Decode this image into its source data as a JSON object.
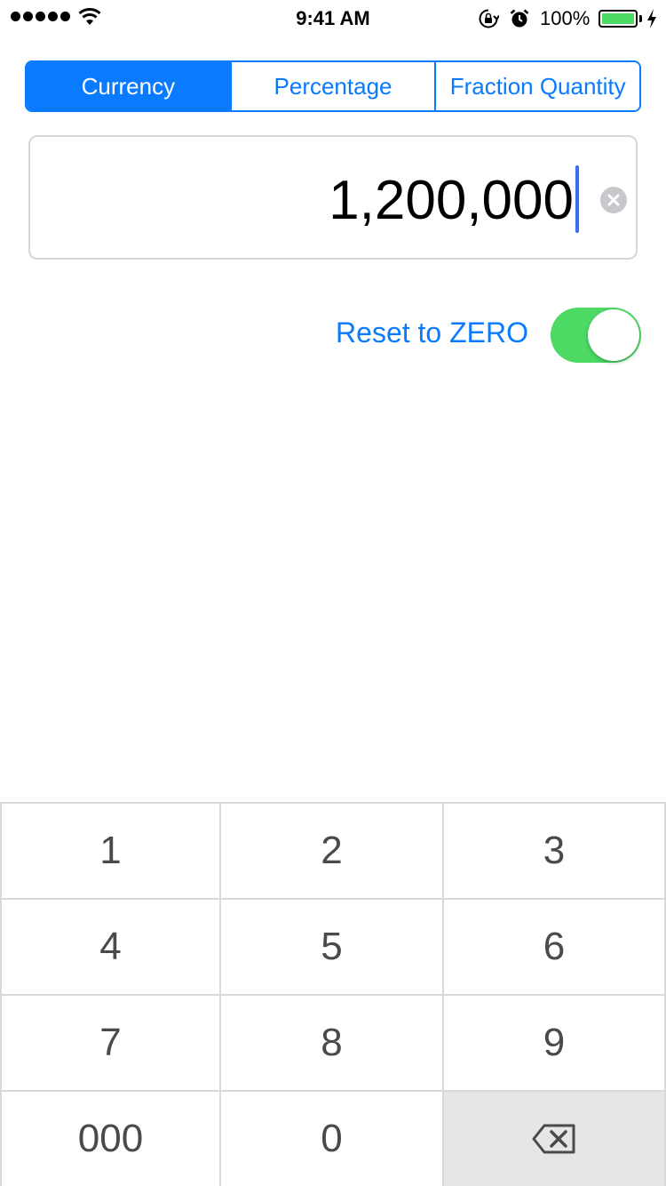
{
  "status_bar": {
    "time": "9:41 AM",
    "battery_percent": "100%",
    "signal_bars": 5,
    "battery_level": 1.0,
    "icons": [
      "signal-dots",
      "wifi-icon",
      "rotation-lock-icon",
      "alarm-icon",
      "battery-icon",
      "charging-bolt-icon"
    ]
  },
  "segmented_control": {
    "selected": "Currency",
    "segments": [
      {
        "label": "Currency"
      },
      {
        "label": "Percentage"
      },
      {
        "label": "Fraction Quantity"
      }
    ]
  },
  "value_field": {
    "value": "1,200,000",
    "clear_icon": "clear-circle-icon"
  },
  "reset": {
    "label": "Reset to ZERO",
    "enabled": true
  },
  "keypad": {
    "keys": [
      {
        "label": "1"
      },
      {
        "label": "2"
      },
      {
        "label": "3"
      },
      {
        "label": "4"
      },
      {
        "label": "5"
      },
      {
        "label": "6"
      },
      {
        "label": "7"
      },
      {
        "label": "8"
      },
      {
        "label": "9"
      },
      {
        "label": "000"
      },
      {
        "label": "0"
      }
    ],
    "delete_icon": "backspace-icon"
  },
  "colors": {
    "accent": "#0a7aff",
    "toggle_on": "#4cd964",
    "battery": "#4cd964",
    "caret": "#3a6cf4",
    "key_text": "#4a4a4a",
    "delete_key_bg": "#e6e6e6"
  }
}
